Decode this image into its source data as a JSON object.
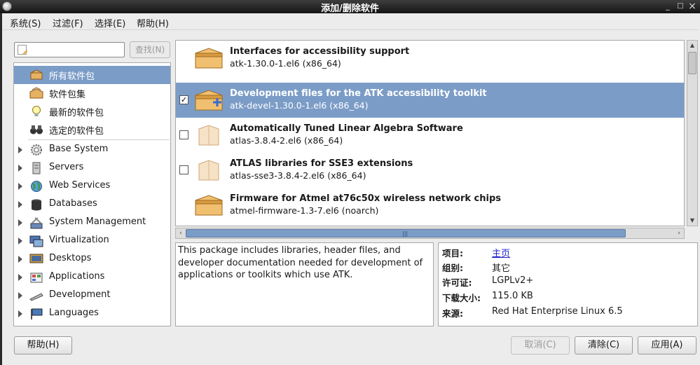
{
  "window": {
    "title": "添加/删除软件",
    "minimize": "_",
    "maximize": "□",
    "close": "×"
  },
  "menu": [
    "系统(S)",
    "过滤(F)",
    "选择(E)",
    "帮助(H)"
  ],
  "search": {
    "value": "",
    "button": "查找(N)"
  },
  "groups": [
    {
      "label": "所有软件包",
      "icon": "box-icon",
      "selected": true
    },
    {
      "label": "软件包集",
      "icon": "package-set-icon"
    },
    {
      "label": "最新的软件包",
      "icon": "lightbulb-icon"
    },
    {
      "label": "选定的软件包",
      "icon": "binoculars-icon"
    }
  ],
  "categories": [
    {
      "label": "Base System",
      "icon": "gear-icon"
    },
    {
      "label": "Servers",
      "icon": "server-icon"
    },
    {
      "label": "Web Services",
      "icon": "globe-icon"
    },
    {
      "label": "Databases",
      "icon": "database-icon"
    },
    {
      "label": "System Management",
      "icon": "tools-icon"
    },
    {
      "label": "Virtualization",
      "icon": "virtualization-icon"
    },
    {
      "label": "Desktops",
      "icon": "desktop-icon"
    },
    {
      "label": "Applications",
      "icon": "applications-icon"
    },
    {
      "label": "Development",
      "icon": "development-icon"
    },
    {
      "label": "Languages",
      "icon": "flag-icon"
    }
  ],
  "packages": [
    {
      "title": "Interfaces for accessibility support",
      "version": "atk-1.30.0-1.el6 (x86_64)",
      "installed": true,
      "checked": null,
      "selected": false
    },
    {
      "title": "Development files for the ATK accessibility toolkit",
      "version": "atk-devel-1.30.0-1.el6 (x86_64)",
      "installed": false,
      "checked": true,
      "selected": true,
      "check_mark": "✓"
    },
    {
      "title": "Automatically Tuned Linear Algebra Software",
      "version": "atlas-3.8.4-2.el6 (x86_64)",
      "installed": false,
      "checked": false,
      "selected": false
    },
    {
      "title": "ATLAS libraries for SSE3 extensions",
      "version": "atlas-sse3-3.8.4-2.el6 (x86_64)",
      "installed": false,
      "checked": false,
      "selected": false
    },
    {
      "title": "Firmware for Atmel at76c50x wireless network chips",
      "version": "atmel-firmware-1.3-7.el6 (noarch)",
      "installed": true,
      "checked": null,
      "selected": false
    }
  ],
  "description": "This package includes libraries, header files, and developer documentation needed for development of applications or toolkits which use ATK.",
  "details": [
    {
      "label": "项目:",
      "value": "主页",
      "link": true
    },
    {
      "label": "组别:",
      "value": "其它"
    },
    {
      "label": "许可证:",
      "value": "LGPLv2+"
    },
    {
      "label": "下载大小:",
      "value": "115.0 KB"
    },
    {
      "label": "来源:",
      "value": "Red Hat Enterprise Linux 6.5"
    }
  ],
  "buttons": {
    "help": "帮助(H)",
    "cancel": "取消(C)",
    "clear": "清除(C)",
    "apply": "应用(A)"
  },
  "colors": {
    "selection": "#7b9cc7",
    "link": "#2222cc"
  }
}
